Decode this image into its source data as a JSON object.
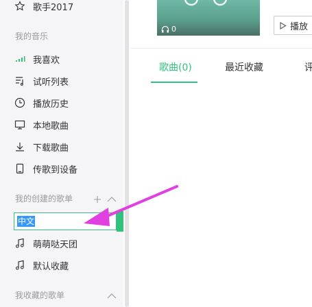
{
  "sidebar": {
    "top_item": {
      "label": "歌手2017",
      "icon": "star-icon"
    },
    "my_music_title": "我的音乐",
    "my_music": [
      {
        "label": "我喜欢",
        "icon": "signal-bars-icon"
      },
      {
        "label": "试听列表",
        "icon": "playlist-icon"
      },
      {
        "label": "播放历史",
        "icon": "clock-icon"
      },
      {
        "label": "本地歌曲",
        "icon": "monitor-icon"
      },
      {
        "label": "下载歌曲",
        "icon": "download-icon"
      },
      {
        "label": "传歌到设备",
        "icon": "phone-icon"
      }
    ],
    "created_title": "我的创建的歌单",
    "editing_value": "中文",
    "created": [
      {
        "label": "萌萌哒天团",
        "icon": "music-note-icon"
      },
      {
        "label": "默认收藏",
        "icon": "music-note-icon"
      }
    ],
    "collected_title": "我收藏的歌单"
  },
  "main": {
    "cover_count": "0",
    "play_label": "播放",
    "tabs": [
      {
        "label": "歌曲(0)"
      },
      {
        "label": "最近收藏"
      },
      {
        "label": "评"
      }
    ]
  },
  "colors": {
    "accent": "#31c27c",
    "annotation_arrow": "#e040e0",
    "selection": "#3399ff"
  }
}
